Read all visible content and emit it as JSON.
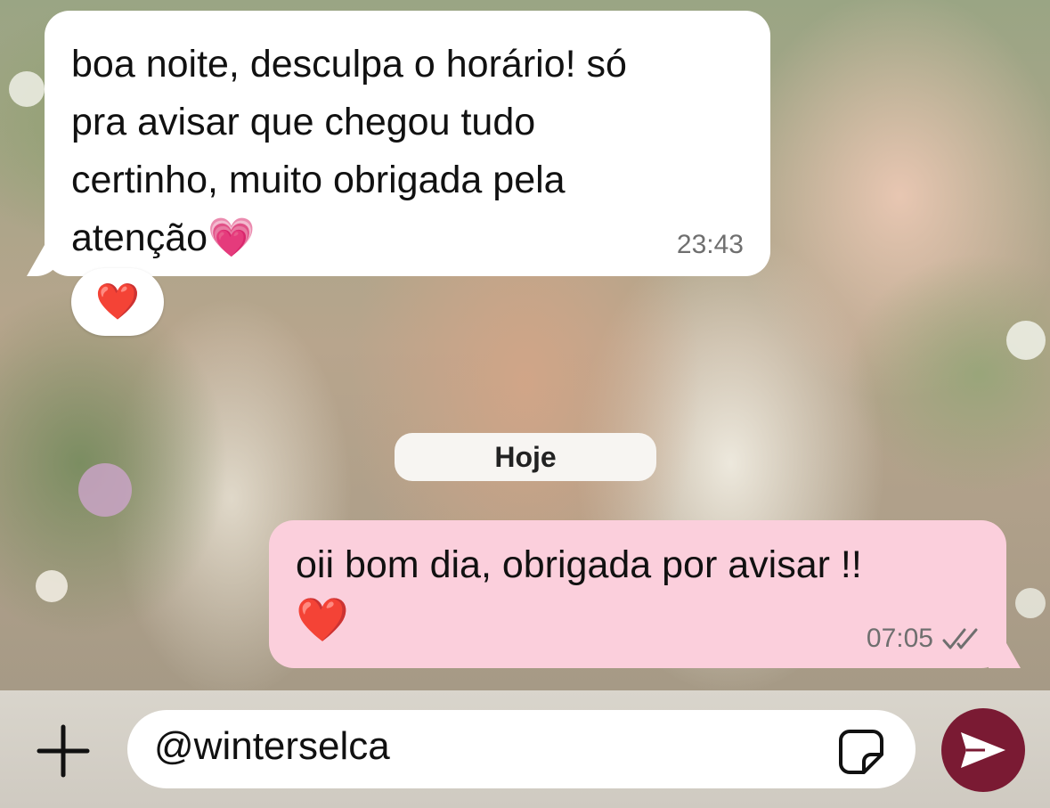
{
  "chat": {
    "incoming": {
      "lines": [
        "boa noite, desculpa o horário! só",
        "pra avisar que chegou tudo",
        "certinho, muito obrigada pela",
        "atenção💗"
      ],
      "time": "23:43",
      "reaction": "❤️"
    },
    "date_separator": "Hoje",
    "outgoing": {
      "line1": "oii bom dia, obrigada por avisar !!",
      "line2": "❤️",
      "time": "07:05",
      "status_icon": "double-check-icon"
    }
  },
  "composer": {
    "input_value": "@winterselca",
    "plus_icon": "plus-icon",
    "sticker_icon": "sticker-icon",
    "send_icon": "send-icon"
  },
  "colors": {
    "incoming_bubble": "#ffffff",
    "outgoing_bubble": "#fbcfdc",
    "send_button": "#7a1a33"
  }
}
